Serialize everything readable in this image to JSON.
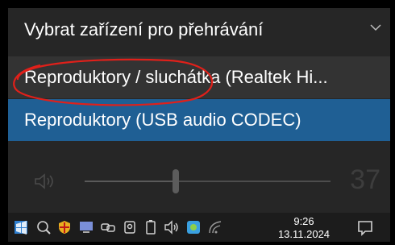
{
  "header": {
    "title": "Vybrat zařízení pro přehrávání",
    "collapse_icon": "chevron-down-icon"
  },
  "devices": [
    {
      "label": "Reproduktory / sluchátka (Realtek Hi...",
      "selected": false
    },
    {
      "label": "Reproduktory (USB audio CODEC)",
      "selected": true
    }
  ],
  "volume": {
    "icon": "speaker-icon",
    "value": "37",
    "level_percent": 37
  },
  "taskbar": {
    "time": "9:26",
    "date": "13.11.2024",
    "icons": [
      "windows-icon",
      "network-icon",
      "security-shield-icon",
      "monitor-icon",
      "link-icon",
      "meet-icon",
      "battery-icon",
      "speaker-icon",
      "app-icon",
      "wifi-icon",
      "notification-icon"
    ]
  },
  "colors": {
    "panel": "#262626",
    "selected": "#1f5f94",
    "hover": "#333333",
    "annotation": "#e0201a"
  }
}
